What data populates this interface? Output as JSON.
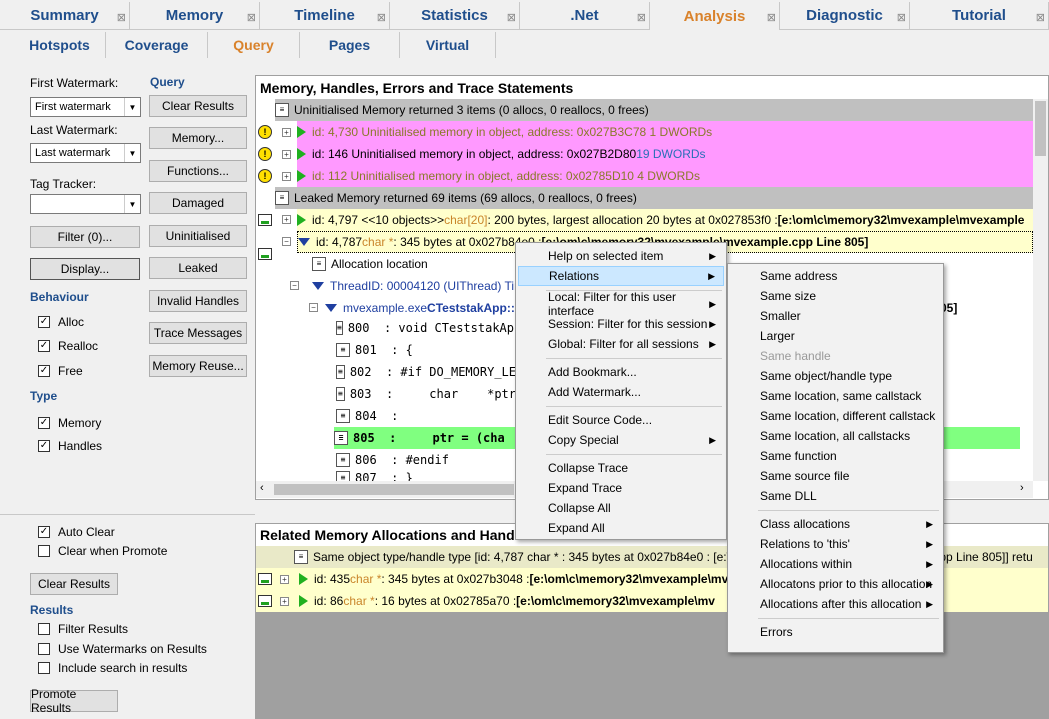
{
  "top_tabs": [
    "Summary",
    "Memory",
    "Timeline",
    "Statistics",
    ".Net",
    "Analysis",
    "Diagnostic",
    "Tutorial"
  ],
  "sub_tabs": [
    "Hotspots",
    "Coverage",
    "Query",
    "Pages",
    "Virtual"
  ],
  "left": {
    "first_watermark_label": "First Watermark:",
    "first_watermark_value": "First watermark",
    "last_watermark_label": "Last Watermark:",
    "last_watermark_value": "Last watermark",
    "tag_tracker_label": "Tag Tracker:",
    "tag_tracker_value": "",
    "filter_button": "Filter (0)...",
    "display_button": "Display...",
    "behaviour_title": "Behaviour",
    "behaviour": [
      "Alloc",
      "Realloc",
      "Free"
    ],
    "type_title": "Type",
    "types": [
      "Memory",
      "Handles"
    ],
    "query_title": "Query",
    "query_buttons": [
      "Clear Results",
      "Memory...",
      "Functions...",
      "Damaged",
      "Uninitialised",
      "Leaked",
      "Invalid Handles",
      "Trace Messages",
      "Memory Reuse..."
    ],
    "auto_clear": "Auto Clear",
    "clear_when_promote": "Clear when Promote",
    "clear_results_button": "Clear Results",
    "results_title": "Results",
    "results_options": [
      "Filter Results",
      "Use Watermarks on Results",
      "Include search in results"
    ],
    "promote_button": "Promote Results"
  },
  "main": {
    "title": "Memory, Handles, Errors and Trace Statements",
    "uninit_header": "Uninitialised Memory returned 3 items (0 allocs, 0 reallocs, 0 frees)",
    "uninit_rows": [
      {
        "text": "id: 4,730 Uninitialised memory in  object, address:  0x027B3C78 1 DWORDs",
        "muted": true
      },
      {
        "text": "id: 146 Uninitialised memory in  object, address:  0x027B2D80 ",
        "tail": "19 DWORDs",
        "muted": false
      },
      {
        "text": "id: 112 Uninitialised memory in  object, address:  0x02785D10 4 DWORDs",
        "muted": true
      }
    ],
    "leak_header": "Leaked Memory returned 69 items (69 allocs, 0 reallocs, 0 frees)",
    "leak_row1": {
      "id": "id: 4,797 <<10 objects>> ",
      "type": "char[20]",
      "rest": " : 200 bytes, largest allocation 20 bytes at 0x027853f0 : ",
      "path": "[e:\\om\\c\\memory32\\mvexample\\mvexample"
    },
    "leak_row2": {
      "id": "id: 4,787 ",
      "type": "char *",
      "rest": " : 345 bytes at 0x027b84e0 : ",
      "path": "[e:\\om\\c\\memory32\\mvexample\\mvexample.cpp Line 805]"
    },
    "alloc_location": "Allocation location",
    "thread": "ThreadID: 00004120  (UIThread)  Tim",
    "frame_exe": "mvexample.exe ",
    "frame_fn": "CTeststakApp::c",
    "frame_tail": "05]",
    "code": [
      {
        "line": "800",
        "text": "  : void CTeststakApp"
      },
      {
        "line": "801",
        "text": "  : {"
      },
      {
        "line": "802",
        "text": "  : #if DO_MEMORY_LE"
      },
      {
        "line": "803",
        "text": "  :     char    *ptr"
      },
      {
        "line": "804",
        "text": "  :"
      },
      {
        "line": "805",
        "text": "  :     ptr = (cha"
      },
      {
        "line": "806",
        "text": "  : #endif"
      },
      {
        "line": "807",
        "text": "  : }"
      }
    ]
  },
  "related": {
    "title": "Related Memory Allocations and Hand",
    "header": "Same object type/handle type [id: 4,787 char * : 345 bytes at 0x027b84e0 : [e:\\",
    "header_tail": ".cpp Line 805]] retu",
    "rows": [
      {
        "id": "id: 435 ",
        "type": "char *",
        "rest": " : 345 bytes at 0x027b3048 : ",
        "path": "[e:\\om\\c\\memory32\\mvexample\\mvexample"
      },
      {
        "id": "id: 86 ",
        "type": "char *",
        "rest": " : 16 bytes at 0x02785a70 : ",
        "path": "[e:\\om\\c\\memory32\\mvexample\\mv"
      }
    ]
  },
  "context_menu": {
    "items": [
      "Help on selected item",
      "Relations",
      "Local: Filter for this user interface",
      "Session: Filter for this session",
      "Global: Filter for all sessions",
      "Add Bookmark...",
      "Add Watermark...",
      "Edit Source Code...",
      "Copy Special",
      "Collapse Trace",
      "Expand Trace",
      "Collapse All",
      "Expand All"
    ]
  },
  "relations_menu": {
    "items": [
      "Same address",
      "Same size",
      "Smaller",
      "Larger",
      "Same handle",
      "Same object/handle type",
      "Same location, same callstack",
      "Same location, different callstack",
      "Same location, all callstacks",
      "Same function",
      "Same source file",
      "Same DLL",
      "Class allocations",
      "Relations to 'this'",
      "Allocations within",
      "Allocatons prior to this allocation",
      "Allocations after this allocation",
      "Errors"
    ]
  }
}
